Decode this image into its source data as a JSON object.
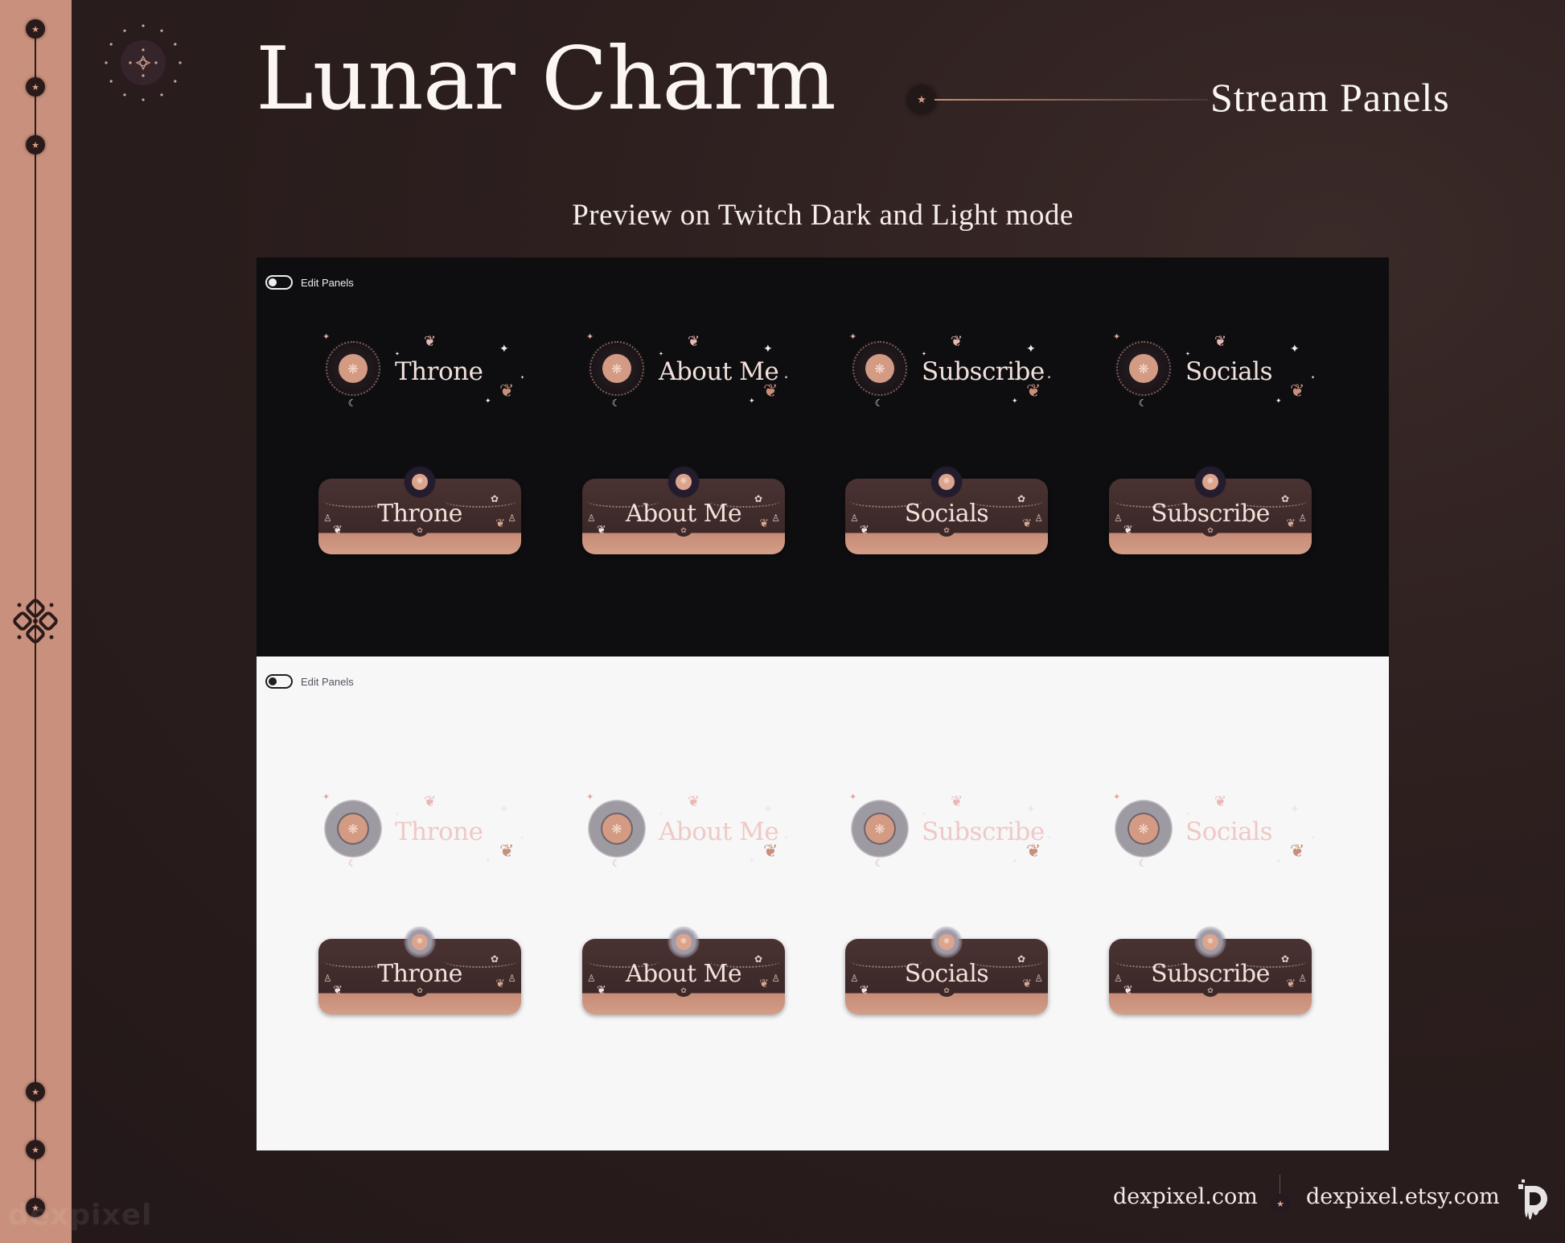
{
  "header": {
    "title": "Lunar Charm",
    "product": "Stream Panels",
    "subtitle": "Preview on Twitch Dark and Light mode"
  },
  "icons": {
    "star": "★",
    "flower": "❋",
    "moon": "☾",
    "butterfly": "❦",
    "sparkle": "✦",
    "lantern": "♙",
    "bow": "✿",
    "ornament": "♢"
  },
  "preview": {
    "dark": {
      "mode": "dark",
      "edit_panels_label": "Edit Panels",
      "edit_panels_on": false,
      "headers": [
        "Throne",
        "About Me",
        "Subscribe",
        "Socials"
      ],
      "buttons": [
        "Throne",
        "About Me",
        "Socials",
        "Subscribe"
      ]
    },
    "light": {
      "mode": "light",
      "edit_panels_label": "Edit Panels",
      "edit_panels_on": false,
      "headers": [
        "Throne",
        "About Me",
        "Subscribe",
        "Socials"
      ],
      "buttons": [
        "Throne",
        "About Me",
        "Socials",
        "Subscribe"
      ]
    }
  },
  "footer": {
    "website": "dexpixel.com",
    "shop": "dexpixel.etsy.com",
    "watermark": "dexpixel"
  },
  "colors": {
    "accent_rose_gold": "#c9917d",
    "background": "#2c1f1e",
    "twitch_dark": "#0e0e10",
    "twitch_light": "#f7f7f8",
    "panel_brown": "#3b2828"
  }
}
